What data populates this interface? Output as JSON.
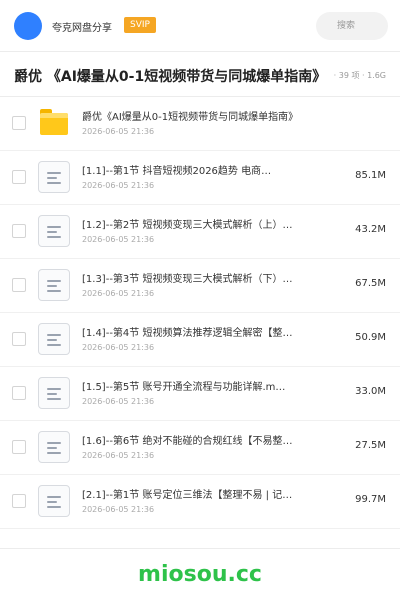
{
  "header": {
    "app_name": "夸克网盘分享",
    "badge": "SVIP",
    "search_placeholder": "搜索"
  },
  "share": {
    "title": "爵优 《AI爆量从0-1短视频带货与同城爆单指南》",
    "meta": "· 39 项 · 1.6G"
  },
  "files": [
    {
      "type": "folder",
      "name": "爵优《AI爆量从0-1短视频带货与同城爆单指南》",
      "date": "2026-06-05 21:36",
      "size": ""
    },
    {
      "type": "file",
      "name": "[1.1]--第1节 抖音短视频2026趋势 电商…",
      "date": "2026-06-05 21:36",
      "size": "85.1M"
    },
    {
      "type": "file",
      "name": "[1.2]--第2节 短视频变现三大模式解析（上）…",
      "date": "2026-06-05 21:36",
      "size": "43.2M"
    },
    {
      "type": "file",
      "name": "[1.3]--第3节 短视频变现三大模式解析（下）…",
      "date": "2026-06-05 21:36",
      "size": "67.5M"
    },
    {
      "type": "file",
      "name": "[1.4]--第4节 短视频算法推荐逻辑全解密【整…",
      "date": "2026-06-05 21:36",
      "size": "50.9M"
    },
    {
      "type": "file",
      "name": "[1.5]--第5节 账号开通全流程与功能详解.m…",
      "date": "2026-06-05 21:36",
      "size": "33.0M"
    },
    {
      "type": "file",
      "name": "[1.6]--第6节 绝对不能碰的合规红线【不易整…",
      "date": "2026-06-05 21:36",
      "size": "27.5M"
    },
    {
      "type": "file",
      "name": "[2.1]--第1节 账号定位三维法【整理不易 | 记…",
      "date": "2026-06-05 21:36",
      "size": "99.7M"
    }
  ],
  "watermark": "miosou.cc",
  "colors": {
    "accent": "#2f80ff",
    "svip": "#f5a623",
    "folder": "#ffc81a",
    "watermark": "#2ec24a"
  }
}
